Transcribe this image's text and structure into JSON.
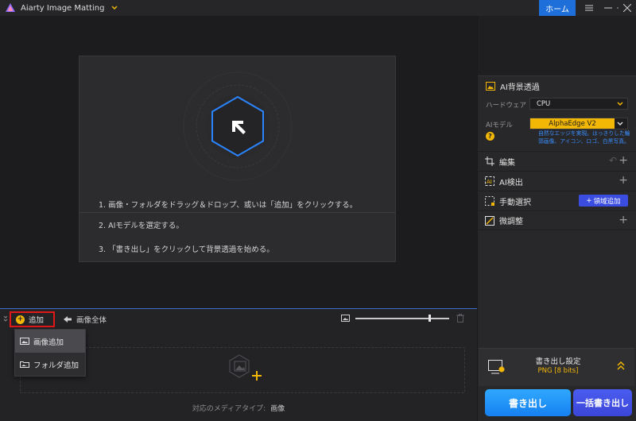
{
  "app": {
    "title": "Aiarty Image Matting",
    "home_label": "ホーム"
  },
  "main": {
    "steps": [
      "1. 画像・フォルダをドラッグ＆ドロップ、或いは「追加」をクリックする。",
      "2. AIモデルを選定する。",
      "3. 「書き出し」をクリックして背景透過を始める。"
    ]
  },
  "media": {
    "add_label": "追加",
    "whole_label": "画像全体",
    "zoom_level": 0.78,
    "supported_label": "対応のメディアタイプ:",
    "supported_value": "画像",
    "dropdown": [
      {
        "label": "画像追加",
        "icon": "image-icon",
        "active": true
      },
      {
        "label": "フォルダ追加",
        "icon": "folder-icon",
        "active": false
      }
    ]
  },
  "right": {
    "ai_bg_title": "AI背景透過",
    "hardware_label": "ハードウェア",
    "hardware_value": "CPU",
    "model_label": "AIモデル",
    "model_value": "AlphaEdge V2",
    "model_hint": "自然なエッジを実現。はっきりした輪郭画像、アイコン、ロゴ、白黒写真。",
    "tools": [
      {
        "label": "編集",
        "icon": "crop-icon"
      },
      {
        "label": "AI検出",
        "icon": "ai-detect-icon"
      },
      {
        "label": "手動選択",
        "icon": "selection-icon"
      },
      {
        "label": "微調整",
        "icon": "adjust-icon"
      }
    ],
    "region_add_label": "領域追加",
    "export_settings_title": "書き出し設定",
    "export_settings_value": "PNG  [8 bits]",
    "export_label": "書き出し",
    "batch_export_label": "一括書き出し",
    "accent": "#f2b705",
    "primary": "#1e6fd9"
  }
}
